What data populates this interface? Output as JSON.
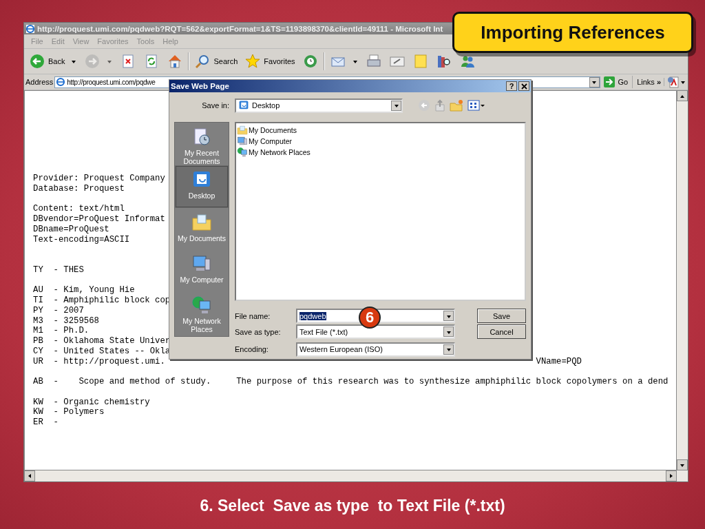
{
  "slide": {
    "title": "Importing References",
    "step_badge": "6",
    "caption": "6. Select  Save as type  to Text File (*.txt)"
  },
  "browser": {
    "title": "http://proquest.umi.com/pqdweb?RQT=562&exportFormat=1&TS=1193898370&clientId=49111 - Microsoft Int",
    "menu": [
      "File",
      "Edit",
      "View",
      "Favorites",
      "Tools",
      "Help"
    ],
    "toolbar": [
      {
        "kind": "back",
        "label": "Back",
        "dropdown": true,
        "disabled": false
      },
      {
        "kind": "forward",
        "dropdown": true,
        "disabled": true
      },
      {
        "kind": "stop",
        "dropdown": false,
        "disabled": false
      },
      {
        "kind": "refresh",
        "dropdown": false,
        "disabled": false
      },
      {
        "kind": "home",
        "dropdown": false,
        "disabled": false
      },
      {
        "kind": "separator"
      },
      {
        "kind": "search",
        "label": "Search",
        "dropdown": false,
        "disabled": false
      },
      {
        "kind": "favorites",
        "label": "Favorites",
        "dropdown": false,
        "disabled": false
      },
      {
        "kind": "history",
        "dropdown": false,
        "disabled": false
      },
      {
        "kind": "separator"
      },
      {
        "kind": "mail",
        "dropdown": true,
        "disabled": false
      },
      {
        "kind": "print",
        "dropdown": false,
        "disabled": false
      },
      {
        "kind": "edit",
        "dropdown": false,
        "disabled": false
      },
      {
        "kind": "note",
        "dropdown": false,
        "disabled": false
      },
      {
        "kind": "research",
        "dropdown": false,
        "disabled": false
      },
      {
        "kind": "messenger",
        "dropdown": false,
        "disabled": false
      }
    ],
    "address": {
      "label": "Address",
      "value": "http://proquest.umi.com/pqdwe"
    },
    "go": "Go",
    "links": "Links",
    "links_more": "»",
    "content_lines": [
      {
        "kind": "text",
        "text": "Provider: Proquest Company"
      },
      {
        "kind": "text",
        "text": "Database: Proquest"
      },
      {
        "kind": "blank"
      },
      {
        "kind": "text",
        "text": "Content: text/html"
      },
      {
        "kind": "text",
        "text": "DBvendor=ProQuest Informat"
      },
      {
        "kind": "text",
        "text": "DBname=ProQuest"
      },
      {
        "kind": "text",
        "text": "Text-encoding=ASCII"
      },
      {
        "kind": "blank"
      },
      {
        "kind": "blank"
      },
      {
        "kind": "text",
        "text": "TY  - THES"
      },
      {
        "kind": "blank"
      },
      {
        "kind": "text",
        "text": "AU  - Kim, Young Hie"
      },
      {
        "kind": "text",
        "text": "TI  - Amphiphilic block cop"
      },
      {
        "kind": "text",
        "text": "PY  - 2007"
      },
      {
        "kind": "text",
        "text": "M3  - 3259568"
      },
      {
        "kind": "text",
        "text": "M1  - Ph.D."
      },
      {
        "kind": "text",
        "text": "PB  - Oklahoma State Univer"
      },
      {
        "kind": "text",
        "text": "CY  - United States -- Okla"
      },
      {
        "kind": "text",
        "text": "UR  - http://proquest.umi.",
        "tail": "VName=PQD"
      },
      {
        "kind": "blank"
      },
      {
        "kind": "text",
        "text": "AB  -    Scope and method of study.     The purpose of this research was to synthesize amphiphilic block copolymers on a dend"
      },
      {
        "kind": "blank"
      },
      {
        "kind": "text",
        "text": "KW  - Organic chemistry"
      },
      {
        "kind": "text",
        "text": "KW  - Polymers"
      },
      {
        "kind": "text",
        "text": "ER  -"
      }
    ]
  },
  "dialog": {
    "title": "Save Web Page",
    "help": "?",
    "save_in": {
      "label": "Save in:",
      "value": "Desktop"
    },
    "places": [
      {
        "kind": "recent",
        "label": "My Recent Documents",
        "selected": false
      },
      {
        "kind": "desktop",
        "label": "Desktop",
        "selected": true
      },
      {
        "kind": "documents",
        "label": "My Documents",
        "selected": false
      },
      {
        "kind": "computer",
        "label": "My Computer",
        "selected": false
      },
      {
        "kind": "network",
        "label": "My Network Places",
        "selected": false
      }
    ],
    "files": [
      {
        "kind": "documents",
        "name": "My Documents"
      },
      {
        "kind": "computer",
        "name": "My Computer"
      },
      {
        "kind": "network",
        "name": "My Network Places"
      }
    ],
    "fields": [
      {
        "label": "File name:",
        "value": "pqdweb",
        "highlighted": true
      },
      {
        "label": "Save as type:",
        "value": "Text File (*.txt)",
        "highlighted": false
      },
      {
        "label": "Encoding:",
        "value": "Western European (ISO)",
        "highlighted": false
      }
    ],
    "buttons": [
      "Save",
      "Cancel"
    ]
  }
}
